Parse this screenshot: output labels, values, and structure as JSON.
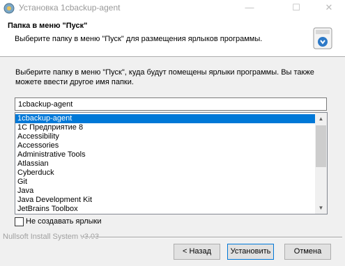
{
  "window": {
    "title": "Установка 1cbackup-agent",
    "minimize_glyph": "—",
    "maximize_glyph": "☐",
    "close_glyph": "✕"
  },
  "header": {
    "title": "Папка в меню \"Пуск\"",
    "subtitle": "Выберите папку в меню \"Пуск\" для размещения ярлыков программы."
  },
  "instruction": "Выберите папку в меню \"Пуск\", куда будут помещены ярлыки программы. Вы также можете ввести другое имя папки.",
  "folder_input": {
    "value": "1cbackup-agent"
  },
  "folder_list": {
    "selected": "1cbackup-agent",
    "items": [
      "1cbackup-agent",
      "1С Предприятие 8",
      "Accessibility",
      "Accessories",
      "Administrative Tools",
      "Atlassian",
      "Cyberduck",
      "Git",
      "Java",
      "Java Development Kit",
      "JetBrains Toolbox"
    ]
  },
  "checkbox": {
    "label": "Не создавать ярлыки",
    "checked": false
  },
  "branding": "Nullsoft Install System v3.03",
  "buttons": {
    "back": "< Назад",
    "install": "Установить",
    "cancel": "Отмена"
  }
}
